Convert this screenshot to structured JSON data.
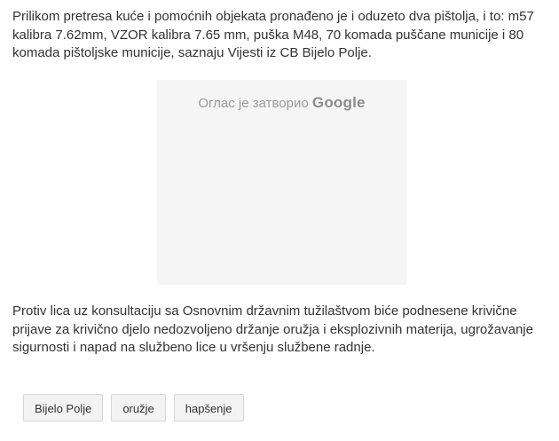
{
  "article": {
    "paragraph_1": "Prilikom pretresa kuće i pomoćnih objekata pronađeno je i oduzeto dva pištolja, i to: m57 kalibra 7.62mm, VZOR kalibra 7.65 mm, puška M48, 70 komada puščane municije i 80 komada pištoljske municije, saznaju Vijesti iz CB Bijelo Polje.",
    "paragraph_2": "Protiv lica uz konsultaciju sa Osnovnim državnim tužilaštvom biće podnesene krivične prijave za krivično djelo nedozvoljeno držanje oružja i eksplozivnih materija, ugrožavanje sigurnosti i napad na službeno lice u vršenju službene radnje."
  },
  "ad": {
    "closed_text": "Оглас је затворио",
    "brand": "Google"
  },
  "tags": [
    {
      "label": "Bijelo Polje"
    },
    {
      "label": "oružje"
    },
    {
      "label": "hapšenje"
    }
  ],
  "colors": {
    "text": "#333333",
    "ad_background": "#f5f5f5",
    "tag_background": "#f3f3f3",
    "tag_border": "#d6d6d6"
  }
}
